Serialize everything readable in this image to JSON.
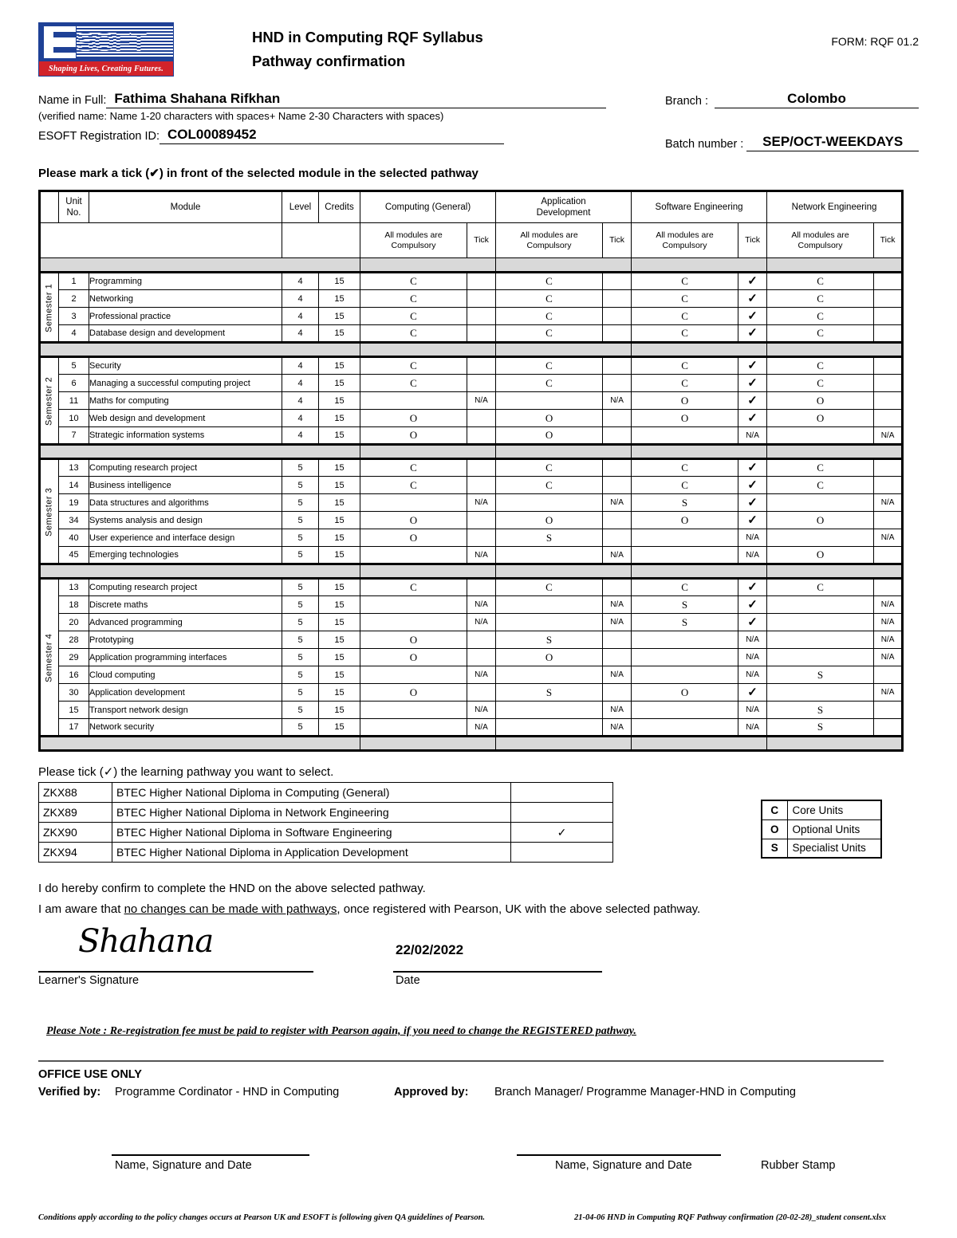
{
  "header": {
    "logo_text": "ESOFT",
    "logo_tagline": "Shaping Lives, Creating Futures.",
    "title_line1": "HND in Computing RQF Syllabus",
    "title_line2": "Pathway confirmation",
    "form_code": "FORM:  RQF 01.2"
  },
  "identity": {
    "name_label": "Name in Full:",
    "name_value": "Fathima Shahana Rifkhan",
    "name_hint": "(verified name: Name 1-20 characters with spaces+ Name 2-30 Characters with spaces)",
    "reg_label": "ESOFT Registration ID:",
    "reg_value": "COL00089452",
    "branch_label": "Branch :",
    "branch_value": "Colombo",
    "batch_label": "Batch number :",
    "batch_value": "SEP/OCT-WEEKDAYS"
  },
  "instruction": "Please mark a tick (✔) in front of the selected module in the selected pathway",
  "table": {
    "headers": {
      "unit_no": "Unit No.",
      "unit_no_l1": "Unit",
      "unit_no_l2": "No.",
      "module": "Module",
      "level": "Level",
      "credits": "Credits",
      "pathways": [
        {
          "name_l1": "Computing (General)",
          "name_l2": ""
        },
        {
          "name_l1": "Application",
          "name_l2": "Development"
        },
        {
          "name_l1": "Software Engineering",
          "name_l2": ""
        },
        {
          "name_l1": "Network Engineering",
          "name_l2": ""
        }
      ],
      "sub_compulsory_l1": "All modules are",
      "sub_compulsory_l2": "Compulsory",
      "sub_tick": "Tick"
    },
    "semesters": [
      {
        "label": "Semester 1",
        "rows": [
          {
            "unit": "1",
            "module": "Programming",
            "level": "4",
            "credits": "15",
            "cg": "C",
            "cg_tick": "",
            "ad": "C",
            "ad_tick": "",
            "se": "C",
            "se_tick": "✓",
            "ne": "C",
            "ne_tick": ""
          },
          {
            "unit": "2",
            "module": "Networking",
            "level": "4",
            "credits": "15",
            "cg": "C",
            "cg_tick": "",
            "ad": "C",
            "ad_tick": "",
            "se": "C",
            "se_tick": "✓",
            "ne": "C",
            "ne_tick": ""
          },
          {
            "unit": "3",
            "module": "Professional practice",
            "level": "4",
            "credits": "15",
            "cg": "C",
            "cg_tick": "",
            "ad": "C",
            "ad_tick": "",
            "se": "C",
            "se_tick": "✓",
            "ne": "C",
            "ne_tick": ""
          },
          {
            "unit": "4",
            "module": "Database design and development",
            "level": "4",
            "credits": "15",
            "cg": "C",
            "cg_tick": "",
            "ad": "C",
            "ad_tick": "",
            "se": "C",
            "se_tick": "✓",
            "ne": "C",
            "ne_tick": ""
          }
        ]
      },
      {
        "label": "Semester 2",
        "rows": [
          {
            "unit": "5",
            "module": "Security",
            "level": "4",
            "credits": "15",
            "cg": "C",
            "cg_tick": "",
            "ad": "C",
            "ad_tick": "",
            "se": "C",
            "se_tick": "✓",
            "ne": "C",
            "ne_tick": ""
          },
          {
            "unit": "6",
            "module": "Managing a successful computing project",
            "level": "4",
            "credits": "15",
            "cg": "C",
            "cg_tick": "",
            "ad": "C",
            "ad_tick": "",
            "se": "C",
            "se_tick": "✓",
            "ne": "C",
            "ne_tick": ""
          },
          {
            "unit": "11",
            "module": "Maths for computing",
            "level": "4",
            "credits": "15",
            "cg": "",
            "cg_tick": "N/A",
            "ad": "",
            "ad_tick": "N/A",
            "se": "O",
            "se_tick": "✓",
            "ne": "O",
            "ne_tick": ""
          },
          {
            "unit": "10",
            "module": "Web design and development",
            "level": "4",
            "credits": "15",
            "cg": "O",
            "cg_tick": "",
            "ad": "O",
            "ad_tick": "",
            "se": "O",
            "se_tick": "✓",
            "ne": "O",
            "ne_tick": ""
          },
          {
            "unit": "7",
            "module": "Strategic information systems",
            "level": "4",
            "credits": "15",
            "cg": "O",
            "cg_tick": "",
            "ad": "O",
            "ad_tick": "",
            "se": "",
            "se_tick": "N/A",
            "ne": "",
            "ne_tick": "N/A"
          }
        ]
      },
      {
        "label": "Semester 3",
        "rows": [
          {
            "unit": "13",
            "module": "Computing research project",
            "level": "5",
            "credits": "15",
            "cg": "C",
            "cg_tick": "",
            "ad": "C",
            "ad_tick": "",
            "se": "C",
            "se_tick": "✓",
            "ne": "C",
            "ne_tick": ""
          },
          {
            "unit": "14",
            "module": "Business intelligence",
            "level": "5",
            "credits": "15",
            "cg": "C",
            "cg_tick": "",
            "ad": "C",
            "ad_tick": "",
            "se": "C",
            "se_tick": "✓",
            "ne": "C",
            "ne_tick": ""
          },
          {
            "unit": "19",
            "module": "Data structures and algorithms",
            "level": "5",
            "credits": "15",
            "cg": "",
            "cg_tick": "N/A",
            "ad": "",
            "ad_tick": "N/A",
            "se": "S",
            "se_tick": "✓",
            "ne": "",
            "ne_tick": "N/A"
          },
          {
            "unit": "34",
            "module": "Systems analysis and design",
            "level": "5",
            "credits": "15",
            "cg": "O",
            "cg_tick": "",
            "ad": "O",
            "ad_tick": "",
            "se": "O",
            "se_tick": "✓",
            "ne": "O",
            "ne_tick": ""
          },
          {
            "unit": "40",
            "module": "User experience and interface design",
            "level": "5",
            "credits": "15",
            "cg": "O",
            "cg_tick": "",
            "ad": "S",
            "ad_tick": "",
            "se": "",
            "se_tick": "N/A",
            "ne": "",
            "ne_tick": "N/A"
          },
          {
            "unit": "45",
            "module": "Emerging technologies",
            "level": "5",
            "credits": "15",
            "cg": "",
            "cg_tick": "N/A",
            "ad": "",
            "ad_tick": "N/A",
            "se": "",
            "se_tick": "N/A",
            "ne": "O",
            "ne_tick": ""
          }
        ]
      },
      {
        "label": "Semester 4",
        "rows": [
          {
            "unit": "13",
            "module": "Computing research project",
            "level": "5",
            "credits": "15",
            "cg": "C",
            "cg_tick": "",
            "ad": "C",
            "ad_tick": "",
            "se": "C",
            "se_tick": "✓",
            "ne": "C",
            "ne_tick": ""
          },
          {
            "unit": "18",
            "module": "Discrete maths",
            "level": "5",
            "credits": "15",
            "cg": "",
            "cg_tick": "N/A",
            "ad": "",
            "ad_tick": "N/A",
            "se": "S",
            "se_tick": "✓",
            "ne": "",
            "ne_tick": "N/A"
          },
          {
            "unit": "20",
            "module": "Advanced programming",
            "level": "5",
            "credits": "15",
            "cg": "",
            "cg_tick": "N/A",
            "ad": "",
            "ad_tick": "N/A",
            "se": "S",
            "se_tick": "✓",
            "ne": "",
            "ne_tick": "N/A"
          },
          {
            "unit": "28",
            "module": "Prototyping",
            "level": "5",
            "credits": "15",
            "cg": "O",
            "cg_tick": "",
            "ad": "S",
            "ad_tick": "",
            "se": "",
            "se_tick": "N/A",
            "ne": "",
            "ne_tick": "N/A"
          },
          {
            "unit": "29",
            "module": "Application programming interfaces",
            "level": "5",
            "credits": "15",
            "cg": "O",
            "cg_tick": "",
            "ad": "O",
            "ad_tick": "",
            "se": "",
            "se_tick": "N/A",
            "ne": "",
            "ne_tick": "N/A"
          },
          {
            "unit": "16",
            "module": "Cloud computing",
            "level": "5",
            "credits": "15",
            "cg": "",
            "cg_tick": "N/A",
            "ad": "",
            "ad_tick": "N/A",
            "se": "",
            "se_tick": "N/A",
            "ne": "S",
            "ne_tick": ""
          },
          {
            "unit": "30",
            "module": "Application development",
            "level": "5",
            "credits": "15",
            "cg": "O",
            "cg_tick": "",
            "ad": "S",
            "ad_tick": "",
            "se": "O",
            "se_tick": "✓",
            "ne": "",
            "ne_tick": "N/A"
          },
          {
            "unit": "15",
            "module": "Transport network design",
            "level": "5",
            "credits": "15",
            "cg": "",
            "cg_tick": "N/A",
            "ad": "",
            "ad_tick": "N/A",
            "se": "",
            "se_tick": "N/A",
            "ne": "S",
            "ne_tick": ""
          },
          {
            "unit": "17",
            "module": "Network security",
            "level": "5",
            "credits": "15",
            "cg": "",
            "cg_tick": "N/A",
            "ad": "",
            "ad_tick": "N/A",
            "se": "",
            "se_tick": "N/A",
            "ne": "S",
            "ne_tick": ""
          }
        ]
      }
    ]
  },
  "pathway_select": {
    "intro": "Please tick (✓) the learning pathway you want to select.",
    "rows": [
      {
        "code": "ZKX88",
        "name": "BTEC Higher National Diploma in Computing (General)",
        "tick": ""
      },
      {
        "code": "ZKX89",
        "name": "BTEC Higher National Diploma in Network Engineering",
        "tick": ""
      },
      {
        "code": "ZKX90",
        "name": "BTEC Higher National Diploma in Software Engineering",
        "tick": "✓"
      },
      {
        "code": "ZKX94",
        "name": "BTEC Higher National Diploma in Application Development",
        "tick": ""
      }
    ]
  },
  "legend": [
    {
      "key": "C",
      "text": "Core Units"
    },
    {
      "key": "O",
      "text": "Optional Units"
    },
    {
      "key": "S",
      "text": "Specialist Units"
    }
  ],
  "declaration": {
    "line1": "I do hereby confirm to complete the HND on the above selected pathway.",
    "line2_a": "I am aware that ",
    "line2_u": "no changes can be made with pathways",
    "line2_b": ", once registered with Pearson, UK with the above selected pathway.",
    "signature_value": "Shahana",
    "signature_caption": "Learner's Signature",
    "date_value": "22/02/2022",
    "date_caption": "Date"
  },
  "note": "Please Note : Re-registration fee must be paid to register with Pearson again, if you need to change the REGISTERED pathway.",
  "office": {
    "title": "OFFICE USE ONLY",
    "verified_label": "Verified by:",
    "verified_value": "Programme Cordinator - HND in Computing",
    "approved_label": "Approved by:",
    "approved_value": "Branch Manager/ Programme Manager-HND in Computing",
    "sign_caption_1": "Name, Signature and Date",
    "sign_caption_2": "Name, Signature and Date",
    "rubber_stamp": "Rubber Stamp"
  },
  "footer": {
    "left": "Conditions apply according to the policy changes occurs at Pearson UK and ESOFT is following given QA guidelines of Pearson.",
    "right": "21-04-06 HND in Computing RQF Pathway confirmation (20-02-28)_student consent.xlsx"
  }
}
